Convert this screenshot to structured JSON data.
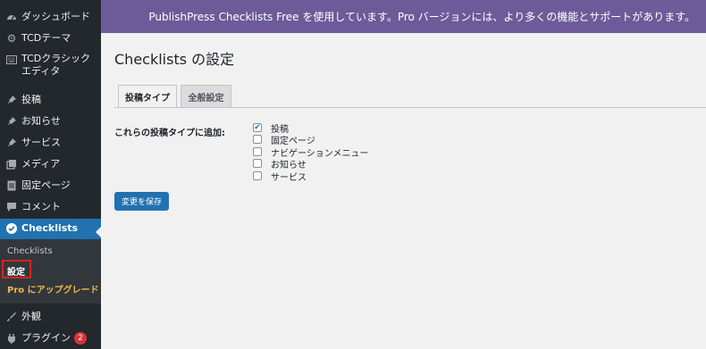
{
  "banner": {
    "text": "PublishPress Checklists Free を使用しています。Pro バージョンには、より多くの機能とサポートがあります。"
  },
  "sidebar": {
    "items": [
      {
        "label": "ダッシュボード",
        "icon": "dashboard-icon"
      },
      {
        "label": "TCDテーマ",
        "icon": "gear-icon"
      },
      {
        "label": "TCDクラシックエディタ",
        "icon": "keyboard-icon"
      },
      {
        "label": "投稿",
        "icon": "pin-icon"
      },
      {
        "label": "お知らせ",
        "icon": "pin-icon"
      },
      {
        "label": "サービス",
        "icon": "pin-icon"
      },
      {
        "label": "メディア",
        "icon": "media-icon"
      },
      {
        "label": "固定ページ",
        "icon": "page-icon"
      },
      {
        "label": "コメント",
        "icon": "comment-icon"
      },
      {
        "label": "Checklists",
        "icon": "check-circle-icon"
      },
      {
        "label": "外観",
        "icon": "brush-icon"
      },
      {
        "label": "プラグイン",
        "icon": "plugin-icon",
        "badge": "2"
      }
    ],
    "submenu": {
      "checklists": "Checklists",
      "settings": "設定",
      "upgrade": "Pro にアップグレード"
    }
  },
  "main": {
    "title": "Checklists の設定",
    "tabs": [
      {
        "label": "投稿タイプ",
        "active": true
      },
      {
        "label": "全般設定",
        "active": false
      }
    ],
    "field_label": "これらの投稿タイプに追加:",
    "options": [
      {
        "label": "投稿",
        "checked": true
      },
      {
        "label": "固定ページ",
        "checked": false
      },
      {
        "label": "ナビゲーションメニュー",
        "checked": false
      },
      {
        "label": "お知らせ",
        "checked": false
      },
      {
        "label": "サービス",
        "checked": false
      }
    ],
    "save_label": "変更を保存"
  },
  "colors": {
    "sidebar_bg": "#23282d",
    "banner_bg": "#6d5a99",
    "accent": "#2271b1",
    "upgrade_text": "#f0b849",
    "highlight_box": "#e0201c"
  }
}
